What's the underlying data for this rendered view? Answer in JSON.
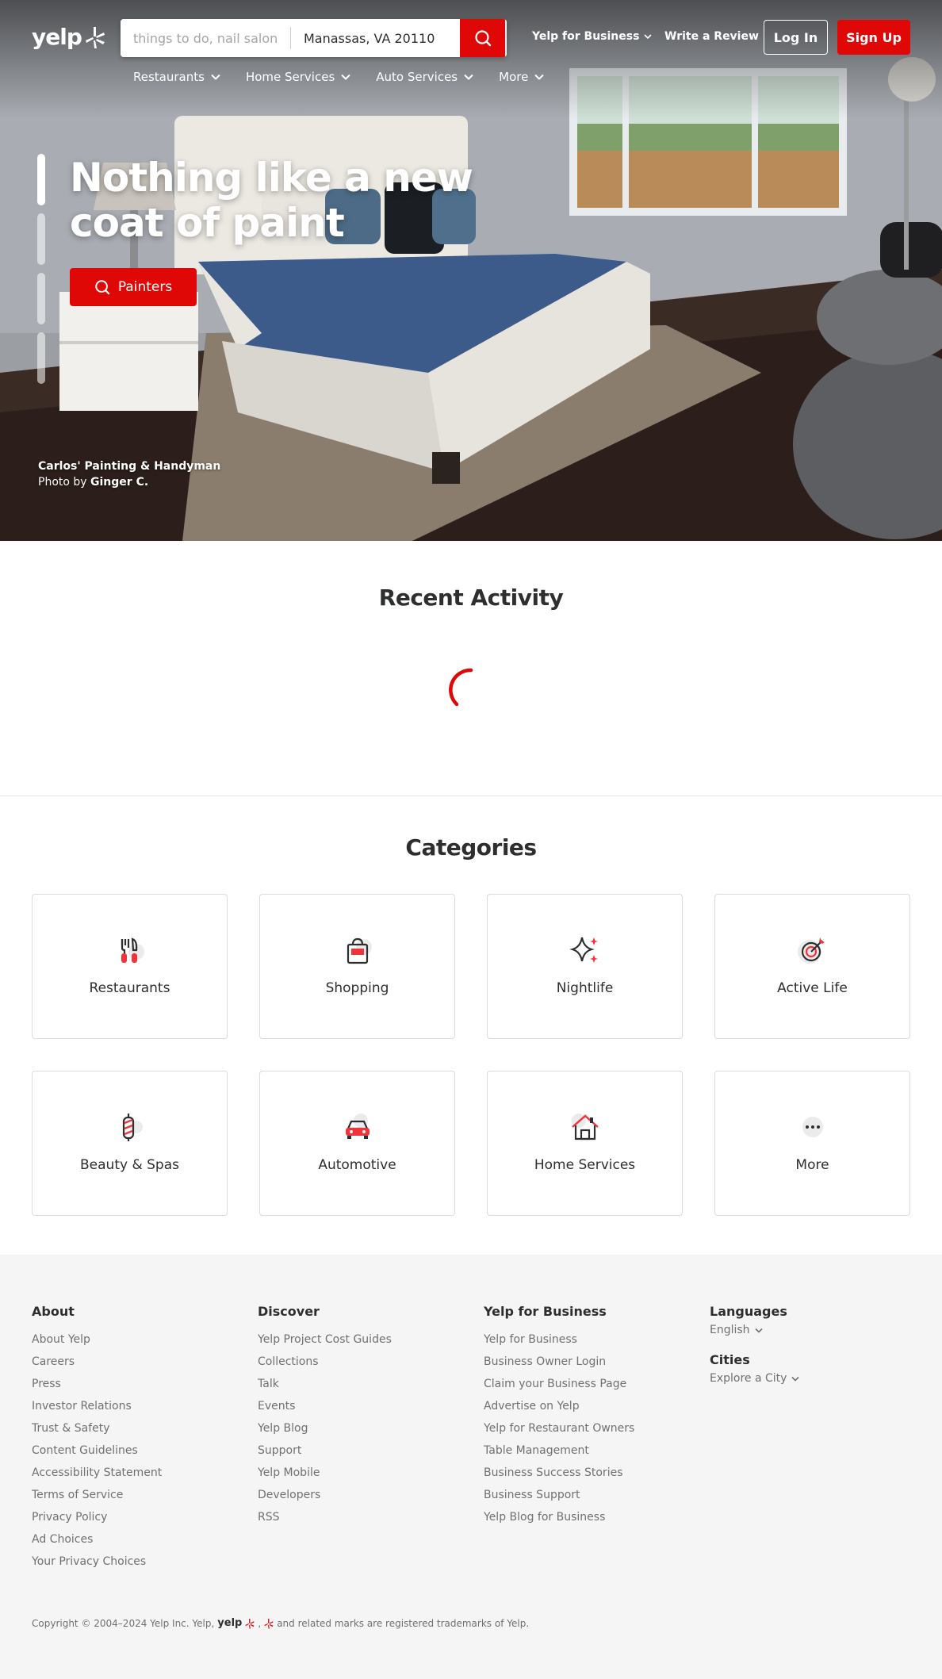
{
  "brand": {
    "logo_text": "yelp",
    "accent_color": "#e00707"
  },
  "header": {
    "search_find_placeholder": "things to do, nail salons, plumbers",
    "search_near_value": "Manassas, VA 20110",
    "yelp_for_business": "Yelp for Business",
    "write_review": "Write a Review",
    "login": "Log In",
    "signup": "Sign Up"
  },
  "category_nav": [
    {
      "label": "Restaurants"
    },
    {
      "label": "Home Services"
    },
    {
      "label": "Auto Services"
    },
    {
      "label": "More"
    }
  ],
  "hero": {
    "headline_line1": "Nothing like a new",
    "headline_line2": "coat of paint",
    "cta_label": "Painters",
    "business": "Carlos' Painting & Handyman",
    "photo_by_prefix": "Photo by",
    "photographer": "Ginger C."
  },
  "recent_activity": {
    "title": "Recent Activity"
  },
  "categories": {
    "title": "Categories",
    "items": [
      {
        "label": "Restaurants",
        "icon": "utensils-icon"
      },
      {
        "label": "Shopping",
        "icon": "shopping-bag-icon"
      },
      {
        "label": "Nightlife",
        "icon": "sparkle-icon"
      },
      {
        "label": "Active Life",
        "icon": "target-icon"
      },
      {
        "label": "Beauty & Spas",
        "icon": "barber-pole-icon"
      },
      {
        "label": "Automotive",
        "icon": "car-icon"
      },
      {
        "label": "Home Services",
        "icon": "house-icon"
      },
      {
        "label": "More",
        "icon": "more-dots-icon"
      }
    ]
  },
  "footer": {
    "about": {
      "title": "About",
      "links": [
        "About Yelp",
        "Careers",
        "Press",
        "Investor Relations",
        "Trust & Safety",
        "Content Guidelines",
        "Accessibility Statement",
        "Terms of Service",
        "Privacy Policy",
        "Ad Choices",
        "Your Privacy Choices"
      ]
    },
    "discover": {
      "title": "Discover",
      "links": [
        "Yelp Project Cost Guides",
        "Collections",
        "Talk",
        "Events",
        "Yelp Blog",
        "Support",
        "Yelp Mobile",
        "Developers",
        "RSS"
      ]
    },
    "business": {
      "title": "Yelp for Business",
      "links": [
        "Yelp for Business",
        "Business Owner Login",
        "Claim your Business Page",
        "Advertise on Yelp",
        "Yelp for Restaurant Owners",
        "Table Management",
        "Business Success Stories",
        "Business Support",
        "Yelp Blog for Business"
      ]
    },
    "languages": {
      "title": "Languages",
      "value": "English"
    },
    "cities": {
      "title": "Cities",
      "value": "Explore a City"
    },
    "copyright_pre": "Copyright © 2004–2024 Yelp Inc. Yelp,",
    "copyright_post": "and related marks are registered trademarks of Yelp."
  }
}
